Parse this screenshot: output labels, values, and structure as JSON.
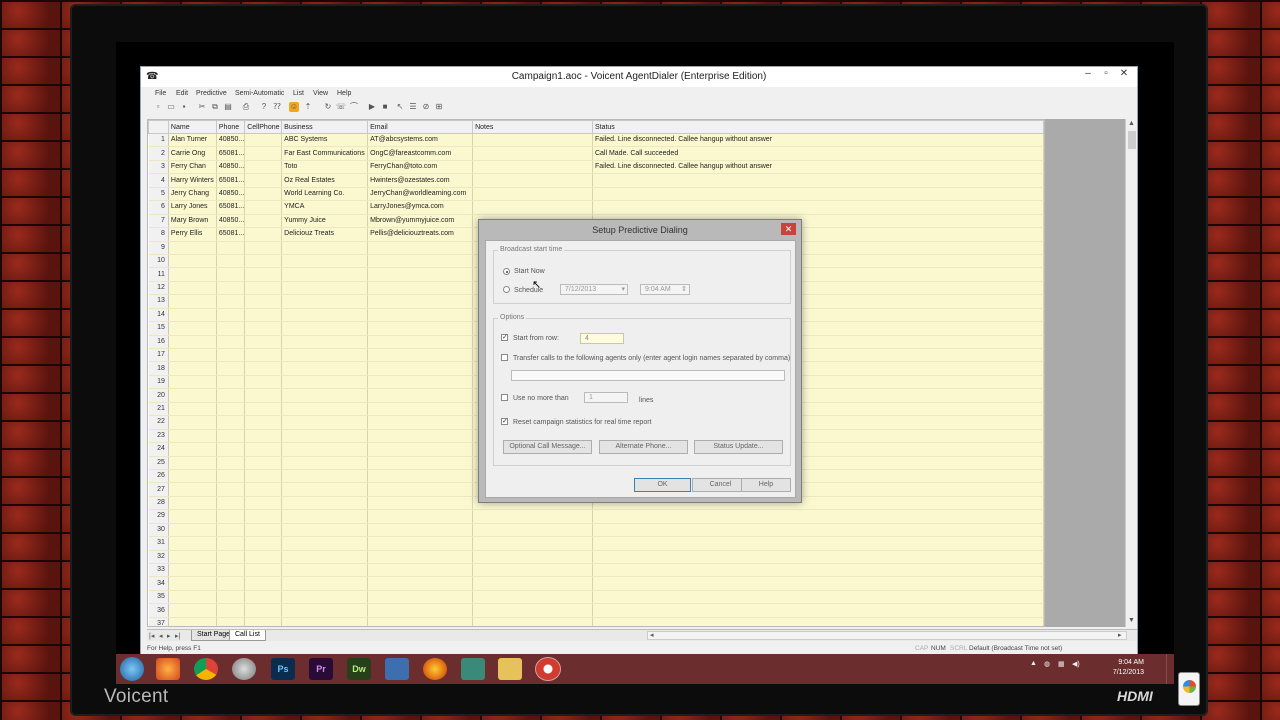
{
  "app": {
    "title": "Campaign1.aoc - Voicent AgentDialer (Enterprise Edition)",
    "menu": [
      "File",
      "Edit",
      "Predictive",
      "Semi-Automatic",
      "List",
      "View",
      "Help"
    ]
  },
  "columns": [
    "",
    "Name",
    "Phone",
    "CellPhone",
    "Business",
    "Email",
    "Notes",
    "Status"
  ],
  "rows": [
    {
      "n": "1",
      "name": "Alan Turner",
      "phone": "40850...",
      "cell": "",
      "business": "ABC Systems",
      "email": "AT@abcsystems.com",
      "notes": "",
      "status": "Failed. Line disconnected. Callee hangup without answer"
    },
    {
      "n": "2",
      "name": "Carrie Ong",
      "phone": "65081...",
      "cell": "",
      "business": "Far East Communications",
      "email": "OngC@fareastcomm.com",
      "notes": "",
      "status": "Call Made. Call succeeded"
    },
    {
      "n": "3",
      "name": "Ferry Chan",
      "phone": "40850...",
      "cell": "",
      "business": "Toto",
      "email": "FerryChan@toto.com",
      "notes": "",
      "status": "Failed. Line disconnected. Callee hangup without answer"
    },
    {
      "n": "4",
      "name": "Harry Winters",
      "phone": "65081...",
      "cell": "",
      "business": "Oz Real Estates",
      "email": "Hwinters@ozestates.com",
      "notes": "",
      "status": ""
    },
    {
      "n": "5",
      "name": "Jerry Chang",
      "phone": "40850...",
      "cell": "",
      "business": "World Learning Co.",
      "email": "JerryChan@worldlearning.com",
      "notes": "",
      "status": ""
    },
    {
      "n": "6",
      "name": "Larry Jones",
      "phone": "65081...",
      "cell": "",
      "business": "YMCA",
      "email": "LarryJones@ymca.com",
      "notes": "",
      "status": ""
    },
    {
      "n": "7",
      "name": "Mary Brown",
      "phone": "40850...",
      "cell": "",
      "business": "Yummy Juice",
      "email": "Mbrown@yummyjuice.com",
      "notes": "",
      "status": ""
    },
    {
      "n": "8",
      "name": "Perry Ellis",
      "phone": "65081...",
      "cell": "",
      "business": "Deliciouz Treats",
      "email": "Pellis@deliciouztreats.com",
      "notes": "",
      "status": ""
    }
  ],
  "empty_row_numbers": [
    "9",
    "10",
    "11",
    "12",
    "13",
    "14",
    "15",
    "16",
    "17",
    "18",
    "19",
    "20",
    "21",
    "22",
    "23",
    "24",
    "25",
    "26",
    "27",
    "28",
    "29",
    "30",
    "31",
    "32",
    "33",
    "34",
    "35",
    "36",
    "37"
  ],
  "sheet_tabs": {
    "start": "Start Page",
    "call_list": "Call List"
  },
  "statusbar": {
    "help": "For Help, press F1",
    "cap": "CAP",
    "num": "NUM",
    "scrl": "SCRL",
    "message": "Default (Broadcast Time not set)"
  },
  "dialog": {
    "title": "Setup Predictive Dialing",
    "close": "✕",
    "broadcast_group": "Broadcast start time",
    "start_now": "Start Now",
    "schedule": "Schedule",
    "date": "7/12/2013",
    "time": "9:04 AM",
    "options_group": "Options",
    "start_from_row_label": "Start from row:",
    "start_from_row_value": "4",
    "transfer_label": "Transfer calls to the following agents only (enter agent login names separated by comma)",
    "transfer_value": "",
    "use_no_more_label": "Use no more than",
    "use_no_more_value": "1",
    "lines_label": "lines",
    "reset_label": "Reset campaign statistics for real time report",
    "optional_msg_btn": "Optional Call Message...",
    "alternate_phone_btn": "Alternate Phone...",
    "status_update_btn": "Status Update...",
    "ok": "OK",
    "cancel": "Cancel",
    "help": "Help"
  },
  "taskbar": {
    "time": "9:04 AM",
    "date": "7/12/2013",
    "icons": [
      "Ps",
      "Pr",
      "Dw"
    ]
  },
  "bezel": {
    "brand": "Voicent",
    "hdmi": "HDMI"
  }
}
